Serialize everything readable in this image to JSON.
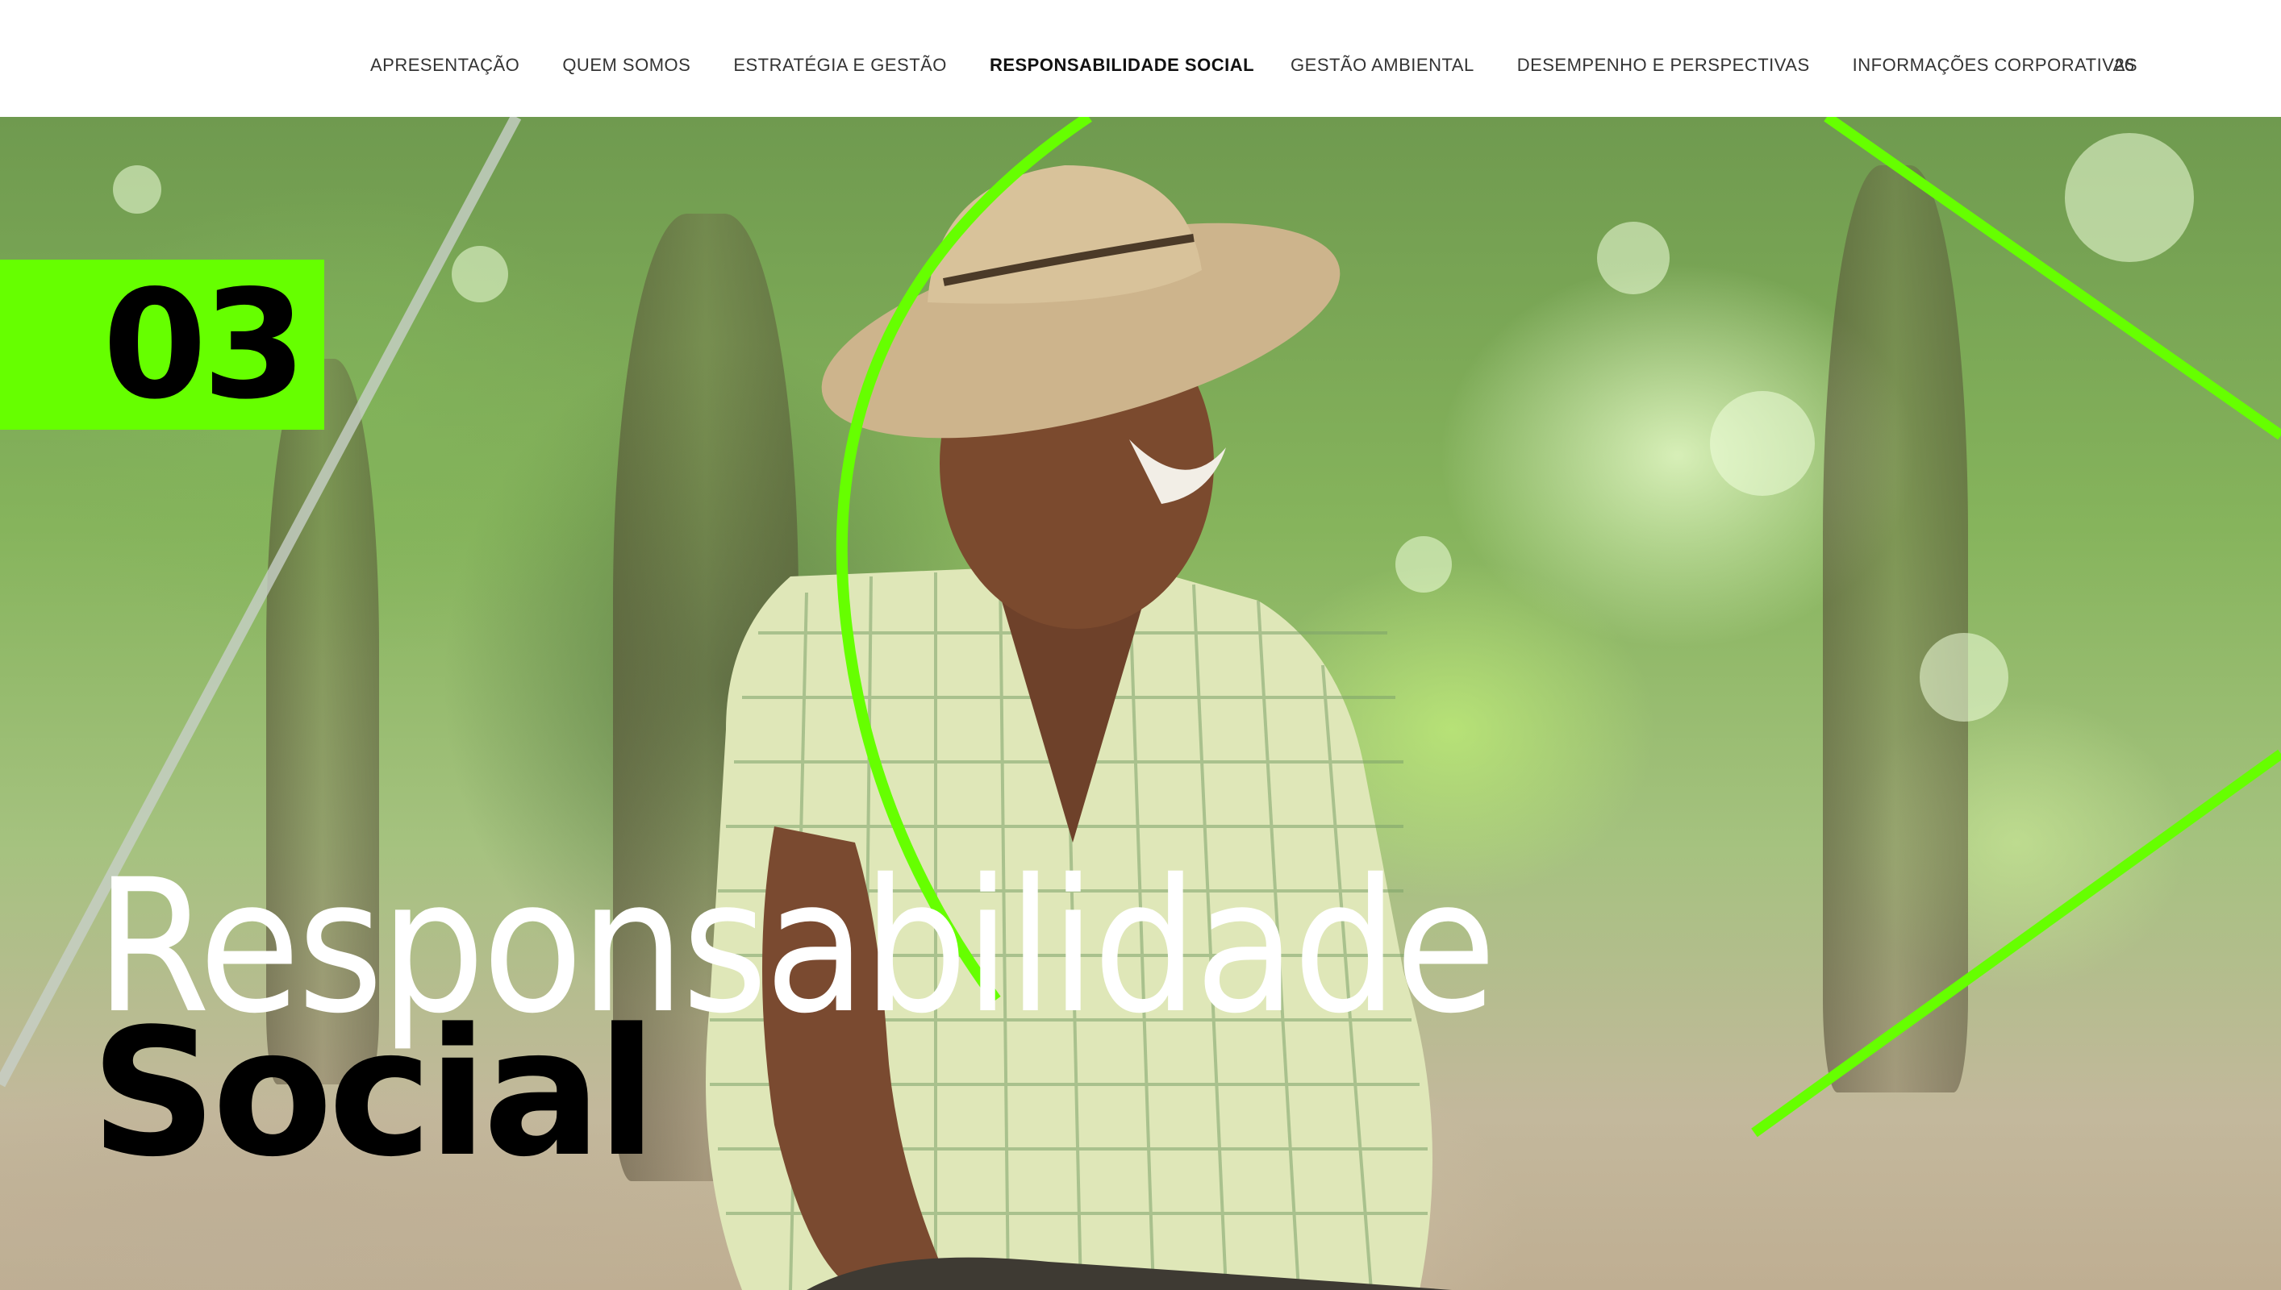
{
  "nav": {
    "items": [
      {
        "label": "APRESENTAÇÃO",
        "active": false
      },
      {
        "label": "QUEM SOMOS",
        "active": false
      },
      {
        "label": "ESTRATÉGIA E GESTÃO",
        "active": false
      },
      {
        "label": "RESPONSABILIDADE SOCIAL",
        "active": true
      },
      {
        "label": "GESTÃO AMBIENTAL",
        "active": false
      },
      {
        "label": "DESEMPENHO E PERSPECTIVAS",
        "active": false
      },
      {
        "label": "INFORMAÇÕES CORPORATIVAS",
        "active": false
      }
    ],
    "page_number": "26"
  },
  "section": {
    "number": "03",
    "title_light": "Responsabilidade",
    "title_bold": "Social"
  },
  "colors": {
    "accent": "#66ff00",
    "nav_text": "#333333",
    "title_light": "#ffffff",
    "title_bold": "#000000"
  }
}
